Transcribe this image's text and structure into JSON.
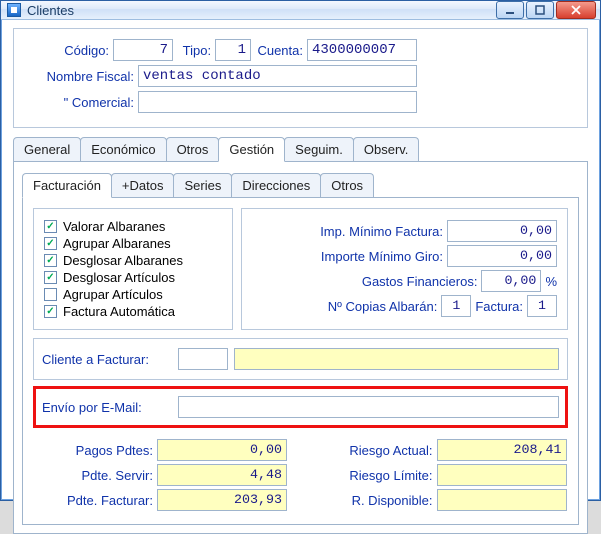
{
  "window": {
    "title": "Clientes"
  },
  "header": {
    "codigo_label": "Código:",
    "codigo_value": "7",
    "tipo_label": "Tipo:",
    "tipo_value": "1",
    "cuenta_label": "Cuenta:",
    "cuenta_value": "4300000007",
    "nombre_fiscal_label": "Nombre Fiscal:",
    "nombre_fiscal_value": "ventas contado",
    "comercial_label": "\"  Comercial:",
    "comercial_value": ""
  },
  "outer_tabs": {
    "general": "General",
    "economico": "Económico",
    "otros": "Otros",
    "gestion": "Gestión",
    "seguim": "Seguim.",
    "observ": "Observ."
  },
  "inner_tabs": {
    "facturacion": "Facturación",
    "masdatos": "+Datos",
    "series": "Series",
    "direcciones": "Direcciones",
    "otros": "Otros"
  },
  "checks": {
    "valorar": {
      "label": "Valorar Albaranes",
      "checked": true
    },
    "agrupar_alb": {
      "label": "Agrupar Albaranes",
      "checked": true
    },
    "desglosar_alb": {
      "label": "Desglosar Albaranes",
      "checked": true
    },
    "desglosar_art": {
      "label": "Desglosar Artículos",
      "checked": true
    },
    "agrupar_art": {
      "label": "Agrupar Artículos",
      "checked": false
    },
    "factura_auto": {
      "label": "Factura Automática",
      "checked": true
    }
  },
  "right_panel": {
    "imp_min_factura_label": "Imp. Mínimo Factura:",
    "imp_min_factura_value": "0,00",
    "importe_min_giro_label": "Importe Mínimo Giro:",
    "importe_min_giro_value": "0,00",
    "gastos_fin_label": "Gastos Financieros:",
    "gastos_fin_value": "0,00",
    "gastos_fin_unit": "%",
    "copias_alb_label": "Nº Copias Albarán:",
    "copias_alb_value": "1",
    "factura_label": "Factura:",
    "factura_value": "1"
  },
  "cliente_facturar": {
    "label": "Cliente a Facturar:",
    "value": ""
  },
  "envio_email": {
    "label": "Envío por E-Mail:",
    "value": ""
  },
  "stats": {
    "pagos_pdtes_label": "Pagos Pdtes:",
    "pagos_pdtes_value": "0,00",
    "pdte_servir_label": "Pdte. Servir:",
    "pdte_servir_value": "4,48",
    "pdte_facturar_label": "Pdte. Facturar:",
    "pdte_facturar_value": "203,93",
    "riesgo_actual_label": "Riesgo Actual:",
    "riesgo_actual_value": "208,41",
    "riesgo_limite_label": "Riesgo Límite:",
    "riesgo_limite_value": "",
    "r_disponible_label": "R. Disponible:",
    "r_disponible_value": ""
  }
}
